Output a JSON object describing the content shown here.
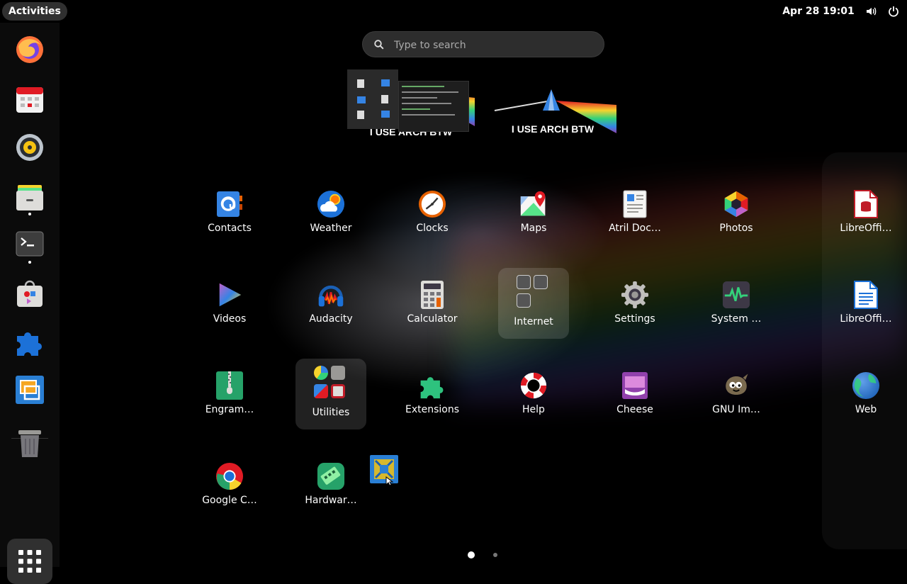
{
  "topbar": {
    "activities_label": "Activities",
    "clock": "Apr 28  19:01",
    "icons": [
      "volume-icon",
      "power-icon"
    ]
  },
  "search": {
    "placeholder": "Type to search"
  },
  "workspaces": [
    {
      "caption": "I USE ARCH BTW"
    },
    {
      "caption": "I USE ARCH BTW"
    }
  ],
  "dash": {
    "items": [
      "firefox",
      "calendar",
      "rhythmbox",
      "files",
      "terminal",
      "software",
      "extensions",
      "virtualbox",
      "trash"
    ],
    "running": [
      "files",
      "terminal"
    ]
  },
  "apps": [
    {
      "label": "Contacts"
    },
    {
      "label": "Weather"
    },
    {
      "label": "Clocks"
    },
    {
      "label": "Maps"
    },
    {
      "label": "Atril Doc…"
    },
    {
      "label": "Photos"
    },
    {
      "label": "LibreOffi…"
    },
    {
      "label": "Videos"
    },
    {
      "label": "Audacity"
    },
    {
      "label": "Calculator"
    },
    {
      "label": "Internet"
    },
    {
      "label": "Settings"
    },
    {
      "label": "System …"
    },
    {
      "label": "LibreOffi…"
    },
    {
      "label": "Engram…"
    },
    {
      "label": "Utilities"
    },
    {
      "label": "Extensions"
    },
    {
      "label": "Help"
    },
    {
      "label": "Cheese"
    },
    {
      "label": "GNU Im…"
    },
    {
      "label": "Web"
    },
    {
      "label": "Google C…"
    },
    {
      "label": "Hardwar…"
    }
  ],
  "pagination": {
    "pages": 2,
    "current": 1
  }
}
